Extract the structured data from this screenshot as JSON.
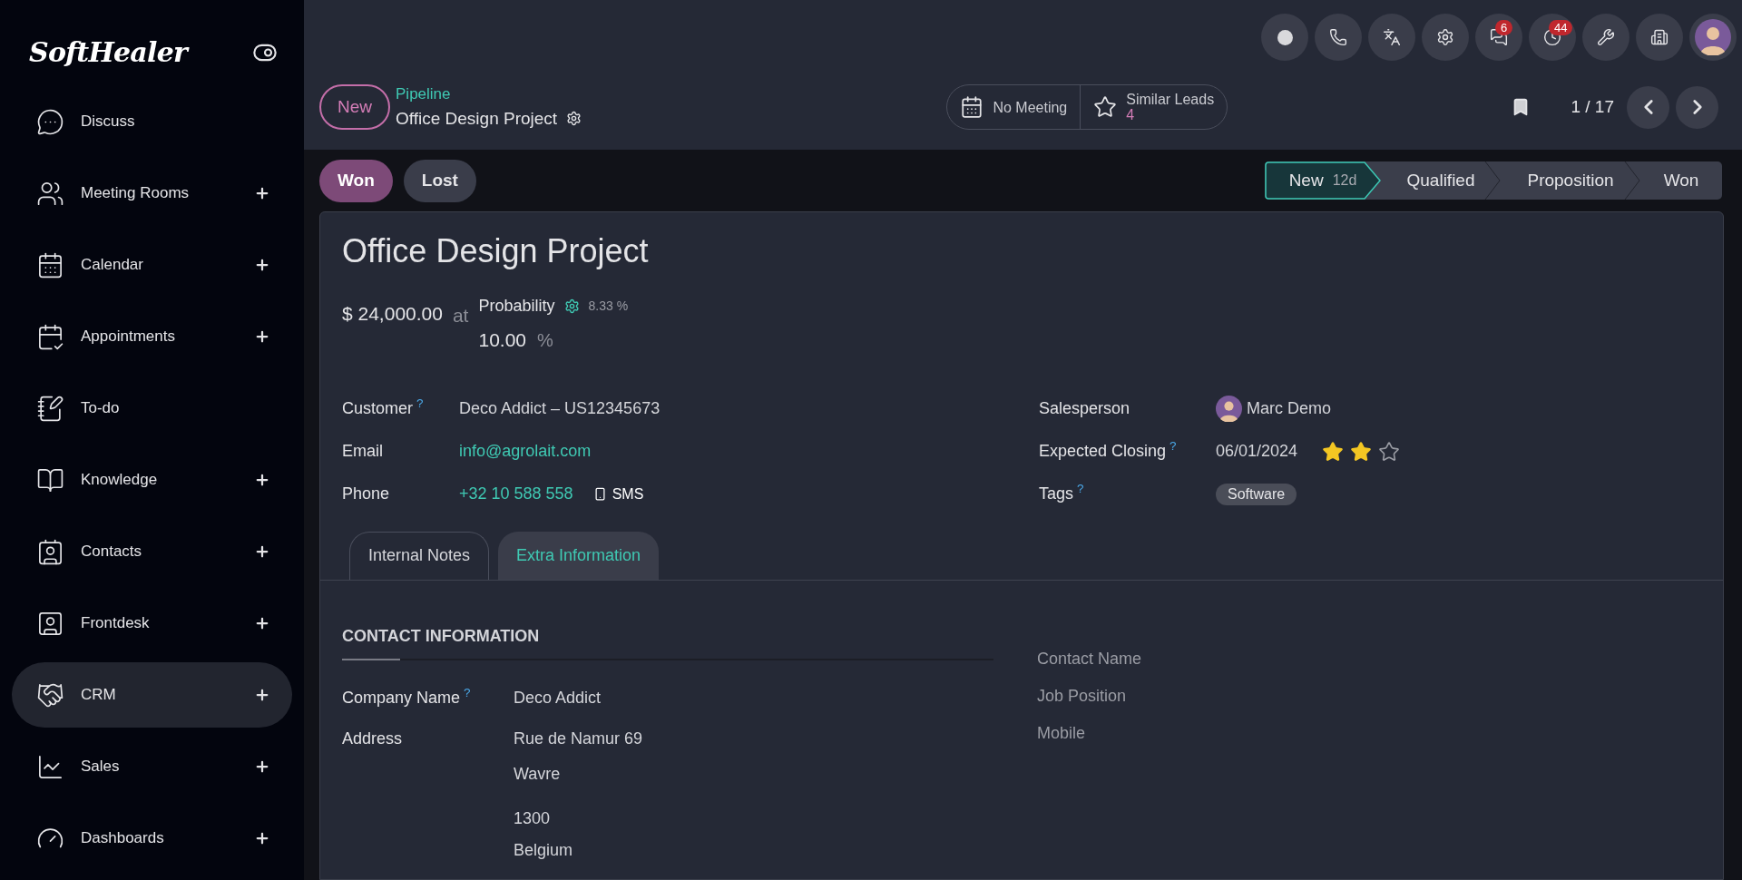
{
  "sidebar": {
    "logo": "SoftHealer",
    "items": [
      {
        "label": "Discuss",
        "expandable": false,
        "selected": false
      },
      {
        "label": "Meeting Rooms",
        "expandable": true,
        "selected": false
      },
      {
        "label": "Calendar",
        "expandable": true,
        "selected": false
      },
      {
        "label": "Appointments",
        "expandable": true,
        "selected": false
      },
      {
        "label": "To-do",
        "expandable": false,
        "selected": false
      },
      {
        "label": "Knowledge",
        "expandable": true,
        "selected": false
      },
      {
        "label": "Contacts",
        "expandable": true,
        "selected": false
      },
      {
        "label": "Frontdesk",
        "expandable": true,
        "selected": false
      },
      {
        "label": "CRM",
        "expandable": true,
        "selected": true
      },
      {
        "label": "Sales",
        "expandable": true,
        "selected": false
      },
      {
        "label": "Dashboards",
        "expandable": true,
        "selected": false
      }
    ]
  },
  "systray": [
    {
      "kind": "status"
    },
    {
      "kind": "phone"
    },
    {
      "kind": "translate"
    },
    {
      "kind": "settings"
    },
    {
      "kind": "messages",
      "badge": "6"
    },
    {
      "kind": "activities",
      "badge": "44"
    },
    {
      "kind": "tools"
    },
    {
      "kind": "company"
    },
    {
      "kind": "avatar"
    }
  ],
  "control_panel": {
    "new_button": "New",
    "breadcrumb": "Pipeline",
    "record": "Office Design Project",
    "smart_buttons": [
      {
        "kind": "meeting",
        "label": "No Meeting"
      },
      {
        "kind": "similar",
        "label": "Similar Leads",
        "count": "4"
      }
    ],
    "pager": "1 / 17"
  },
  "actions": [
    {
      "label": "Won",
      "kind": "primary"
    },
    {
      "label": "Lost",
      "kind": "secondary"
    }
  ],
  "stages": [
    {
      "label": "New",
      "duration": "12d",
      "selected": true
    },
    {
      "label": "Qualified",
      "selected": false
    },
    {
      "label": "Proposition",
      "selected": false
    },
    {
      "label": "Won",
      "selected": false
    }
  ],
  "form": {
    "title": "Office Design Project",
    "revenue": "$ 24,000.00",
    "at": "at",
    "probability_label": "Probability",
    "automated_probability": "8.33 %",
    "probability": "10.00",
    "percent": "%",
    "left_fields": [
      {
        "label": "Customer",
        "help": "?",
        "value": "Deco Addict – US12345673",
        "kind": "text"
      },
      {
        "label": "Email",
        "value": "info@agrolait.com",
        "kind": "link"
      },
      {
        "label": "Phone",
        "value": "+32 10 588 558",
        "kind": "phone",
        "sms": "SMS"
      }
    ],
    "right_fields": [
      {
        "label": "Salesperson",
        "value": "Marc Demo",
        "kind": "user"
      },
      {
        "label": "Expected Closing",
        "help": "?",
        "value": "06/01/2024",
        "kind": "date",
        "stars": 2
      },
      {
        "label": "Tags",
        "help": "?",
        "value": "Software",
        "kind": "tag"
      }
    ],
    "tabs": [
      {
        "label": "Internal Notes",
        "selected": false
      },
      {
        "label": "Extra Information",
        "selected": true
      }
    ],
    "contact": {
      "heading": "CONTACT INFORMATION",
      "company_label": "Company Name",
      "company_help": "?",
      "company": "Deco Addict",
      "address_label": "Address",
      "street": "Rue de Namur 69",
      "city": "Wavre",
      "zip": "1300",
      "country": "Belgium",
      "empty_fields": [
        "Contact Name",
        "Job Position",
        "Mobile"
      ]
    }
  }
}
